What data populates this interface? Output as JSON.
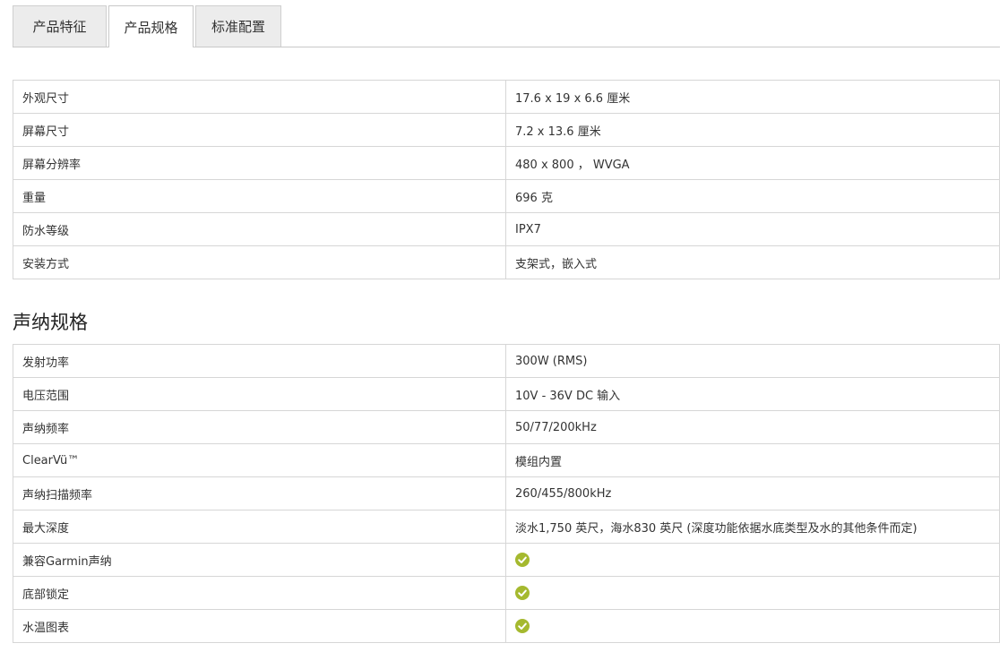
{
  "tabs": [
    {
      "label": "产品特征",
      "active": false
    },
    {
      "label": "产品规格",
      "active": true
    },
    {
      "label": "标准配置",
      "active": false
    }
  ],
  "general_specs": {
    "rows": [
      {
        "label": "外观尺寸",
        "value": "17.6 x 19 x 6.6 厘米"
      },
      {
        "label": "屏幕尺寸",
        "value": "7.2 x 13.6 厘米"
      },
      {
        "label": "屏幕分辨率",
        "value": "480 x 800 ， WVGA"
      },
      {
        "label": "重量",
        "value": "696 克"
      },
      {
        "label": "防水等级",
        "value": "IPX7"
      },
      {
        "label": "安装方式",
        "value": "支架式，嵌入式"
      }
    ]
  },
  "sonar_specs": {
    "title": "声纳规格",
    "rows": [
      {
        "label": "发射功率",
        "value": "300W (RMS)"
      },
      {
        "label": "电压范围",
        "value": "10V - 36V DC 输入"
      },
      {
        "label": "声纳频率",
        "value": "50/77/200kHz"
      },
      {
        "label": "ClearVü™",
        "value": "模组内置"
      },
      {
        "label": "声纳扫描频率",
        "value": "260/455/800kHz"
      },
      {
        "label": "最大深度",
        "value": "淡水1,750 英尺，海水830 英尺 (深度功能依据水底类型及水的其他条件而定)"
      },
      {
        "label": "兼容Garmin声纳",
        "check": true
      },
      {
        "label": "底部锁定",
        "check": true
      },
      {
        "label": "水温图表",
        "check": true
      }
    ]
  },
  "colors": {
    "check": "#a5b92f",
    "border": "#d6d6d6",
    "tab_bg": "#ececec"
  },
  "icons": {
    "supported": "check-circle-icon"
  }
}
